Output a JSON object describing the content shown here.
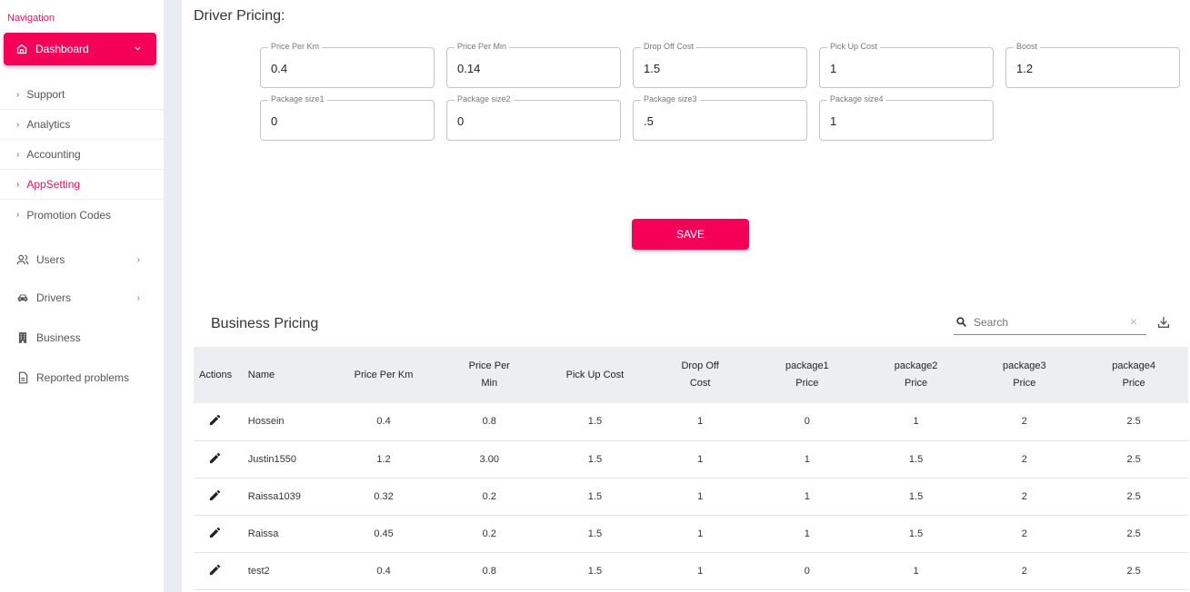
{
  "sidebar": {
    "heading": "Navigation",
    "dashboard_label": "Dashboard",
    "sub_items": [
      {
        "label": "Support",
        "active": false
      },
      {
        "label": "Analytics",
        "active": false
      },
      {
        "label": "Accounting",
        "active": false
      },
      {
        "label": "AppSetting",
        "active": true
      },
      {
        "label": "Promotion Codes",
        "active": false
      }
    ],
    "main_items": [
      {
        "label": "Users",
        "icon": "users-icon",
        "has_chevron": true
      },
      {
        "label": "Drivers",
        "icon": "car-icon",
        "has_chevron": true
      },
      {
        "label": "Business",
        "icon": "building-icon",
        "has_chevron": false
      },
      {
        "label": "Reported problems",
        "icon": "report-icon",
        "has_chevron": false
      }
    ]
  },
  "driver_pricing": {
    "title": "Driver Pricing:",
    "fields": [
      {
        "label": "Price Per Km",
        "value": "0.4"
      },
      {
        "label": "Price Per Min",
        "value": "0.14"
      },
      {
        "label": "Drop Off Cost",
        "value": "1.5"
      },
      {
        "label": "Pick Up Cost",
        "value": "1"
      },
      {
        "label": "Boost",
        "value": "1.2"
      },
      {
        "label": "Package size1",
        "value": "0"
      },
      {
        "label": "Package size2",
        "value": "0"
      },
      {
        "label": "Package size3",
        "value": ".5"
      },
      {
        "label": "Package size4",
        "value": "1"
      }
    ],
    "save_label": "SAVE"
  },
  "business_pricing": {
    "title": "Business Pricing",
    "search_placeholder": "Search",
    "columns": [
      "Actions",
      "Name",
      "Price Per Km",
      "Price Per Min",
      "Pick Up Cost",
      "Drop Off Cost",
      "package1 Price",
      "package2 Price",
      "package3 Price",
      "package4 Price"
    ],
    "rows": [
      [
        "Hossein",
        "0.4",
        "0.8",
        "1.5",
        "1",
        "0",
        "1",
        "2",
        "2.5"
      ],
      [
        "Justin1550",
        "1.2",
        "3.00",
        "1.5",
        "1",
        "1",
        "1.5",
        "2",
        "2.5"
      ],
      [
        "Raissa1039",
        "0.32",
        "0.2",
        "1.5",
        "1",
        "1",
        "1.5",
        "2",
        "2.5"
      ],
      [
        "Raissa",
        "0.45",
        "0.2",
        "1.5",
        "1",
        "1",
        "1.5",
        "2",
        "2.5"
      ],
      [
        "test2",
        "0.4",
        "0.8",
        "1.5",
        "1",
        "0",
        "1",
        "2",
        "2.5"
      ]
    ]
  },
  "colors": {
    "accent": "#f50057",
    "accent_text": "#e8125c",
    "sidebar_gutter": "#e9ecf1",
    "table_header": "#eceef2"
  }
}
